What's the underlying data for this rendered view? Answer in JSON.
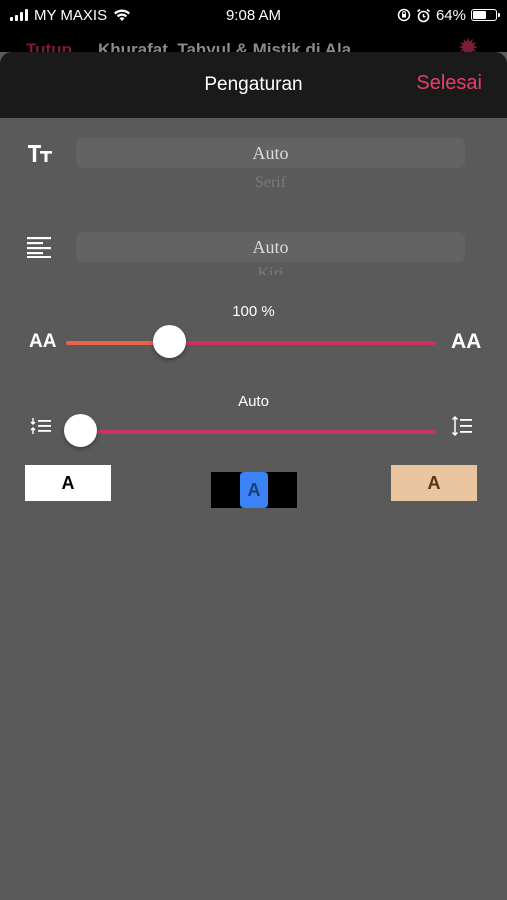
{
  "status_bar": {
    "carrier": "MY MAXIS",
    "time": "9:08 AM",
    "battery": "64%",
    "battery_level": 0.64
  },
  "background_page": {
    "back_label": "Tutup",
    "title": "Khurafat, Tahyul & Mistik di Ala"
  },
  "sheet": {
    "title": "Pengaturan",
    "done_label": "Selesai"
  },
  "font_picker": {
    "selected": "Auto",
    "next_option": "Serif"
  },
  "alignment_picker": {
    "selected": "Auto",
    "next_option": "Kiri"
  },
  "font_size_slider": {
    "value_label": "100 %",
    "position": 0.28,
    "small_glyph": "AA",
    "large_glyph": "AA"
  },
  "line_spacing_slider": {
    "value_label": "Auto",
    "position": 0.04
  },
  "themes": [
    {
      "name": "white",
      "label": "A"
    },
    {
      "name": "black",
      "label": "A"
    },
    {
      "name": "sepia",
      "label": "A"
    }
  ],
  "colors": {
    "accent": "#e83e6c",
    "slider_track": "#c9335e",
    "slider_fill": "#e8614a",
    "selected_theme": "#3b82f6",
    "sepia": "#e9c6a0"
  }
}
